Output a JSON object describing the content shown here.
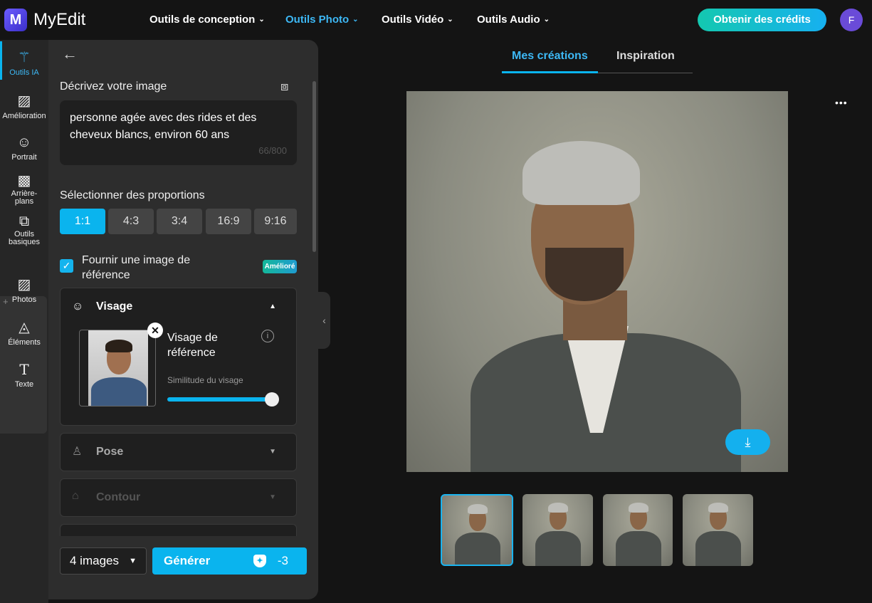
{
  "header": {
    "logo_letter": "M",
    "app_name": "MyEdit",
    "nav": [
      "Outils de conception",
      "Outils Photo",
      "Outils Vidéo",
      "Outils Audio"
    ],
    "active_nav": "Outils Photo",
    "credits_button": "Obtenir des crédits",
    "avatar_initial": "F"
  },
  "rail": [
    "Outils IA",
    "Amélioration",
    "Portrait",
    "Arrière-plans",
    "Outils basiques",
    "Photos",
    "Éléments",
    "Texte"
  ],
  "panel": {
    "describe_label": "Décrivez votre image",
    "prompt": "personne agée avec des rides et des cheveux blancs, environ 60 ans",
    "prompt_words": [
      "personne",
      "agée",
      "avec des rides et des",
      "cheveux",
      "blancs",
      ", environ 60",
      "ans"
    ],
    "char_count": "66/800",
    "ratio_label": "Sélectionner des proportions",
    "ratios": [
      "1:1",
      "4:3",
      "3:4",
      "16:9",
      "9:16"
    ],
    "selected_ratio": "1:1",
    "reference_label": "Fournir une image de référence",
    "reference_checked": true,
    "badge": "Amélioré",
    "face_section": "Visage",
    "face_ref_title": "Visage de référence",
    "similarity_label": "Similitude du visage",
    "similarity_value": 1.0,
    "pose_section": "Pose",
    "contour_section": "Contour",
    "count_select": "4 images",
    "generate_button": "Générer",
    "cost": "-3"
  },
  "main": {
    "tabs": [
      "Mes créations",
      "Inspiration"
    ],
    "active_tab": "Mes créations",
    "more": "•••"
  },
  "colors": {
    "accent": "#0ab4ee",
    "bg": "#141414",
    "panel": "#2d2d2d"
  }
}
